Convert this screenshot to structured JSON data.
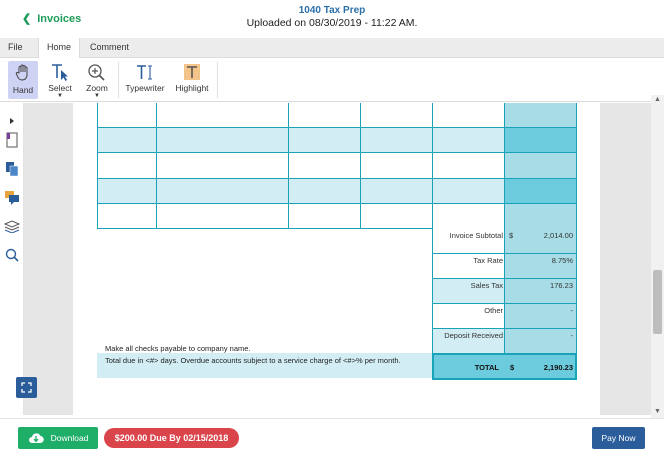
{
  "header": {
    "back_label": "Invoices",
    "title": "1040 Tax Prep",
    "subtitle": "Uploaded on 08/30/2019 - 11:22 AM."
  },
  "tabs": [
    {
      "label": "File",
      "active": false
    },
    {
      "label": "Home",
      "active": true
    },
    {
      "label": "Comment",
      "active": false
    }
  ],
  "toolbar": {
    "hand": "Hand",
    "select": "Select",
    "zoom": "Zoom",
    "typewriter": "Typewriter",
    "highlight": "Highlight"
  },
  "invoice": {
    "summary": [
      {
        "label": "Invoice Subtotal",
        "currency": "$",
        "value": "2,014.00"
      },
      {
        "label": "Tax Rate",
        "currency": "",
        "value": "8.75%"
      },
      {
        "label": "Sales Tax",
        "currency": "",
        "value": "176.23"
      },
      {
        "label": "Other",
        "currency": "",
        "value": "-"
      },
      {
        "label": "Deposit Received",
        "currency": "",
        "value": "-"
      }
    ],
    "total": {
      "label": "TOTAL",
      "currency": "$",
      "value": "2,190.23"
    },
    "note_checks": "Make all checks payable to company name.",
    "note_terms": "Total due in <#> days. Overdue accounts subject to a service charge of <#>% per month."
  },
  "footer": {
    "download_label": "Download",
    "due_label": "$200.00 Due By 02/15/2018",
    "pay_label": "Pay Now"
  },
  "colors": {
    "accent_green": "#1fae68",
    "due_red": "#d9454b",
    "brand_blue": "#2b5d9b",
    "table_border": "#19a3b8",
    "row_light": "#d2eef4",
    "col_dark": "#6ccbdc"
  }
}
